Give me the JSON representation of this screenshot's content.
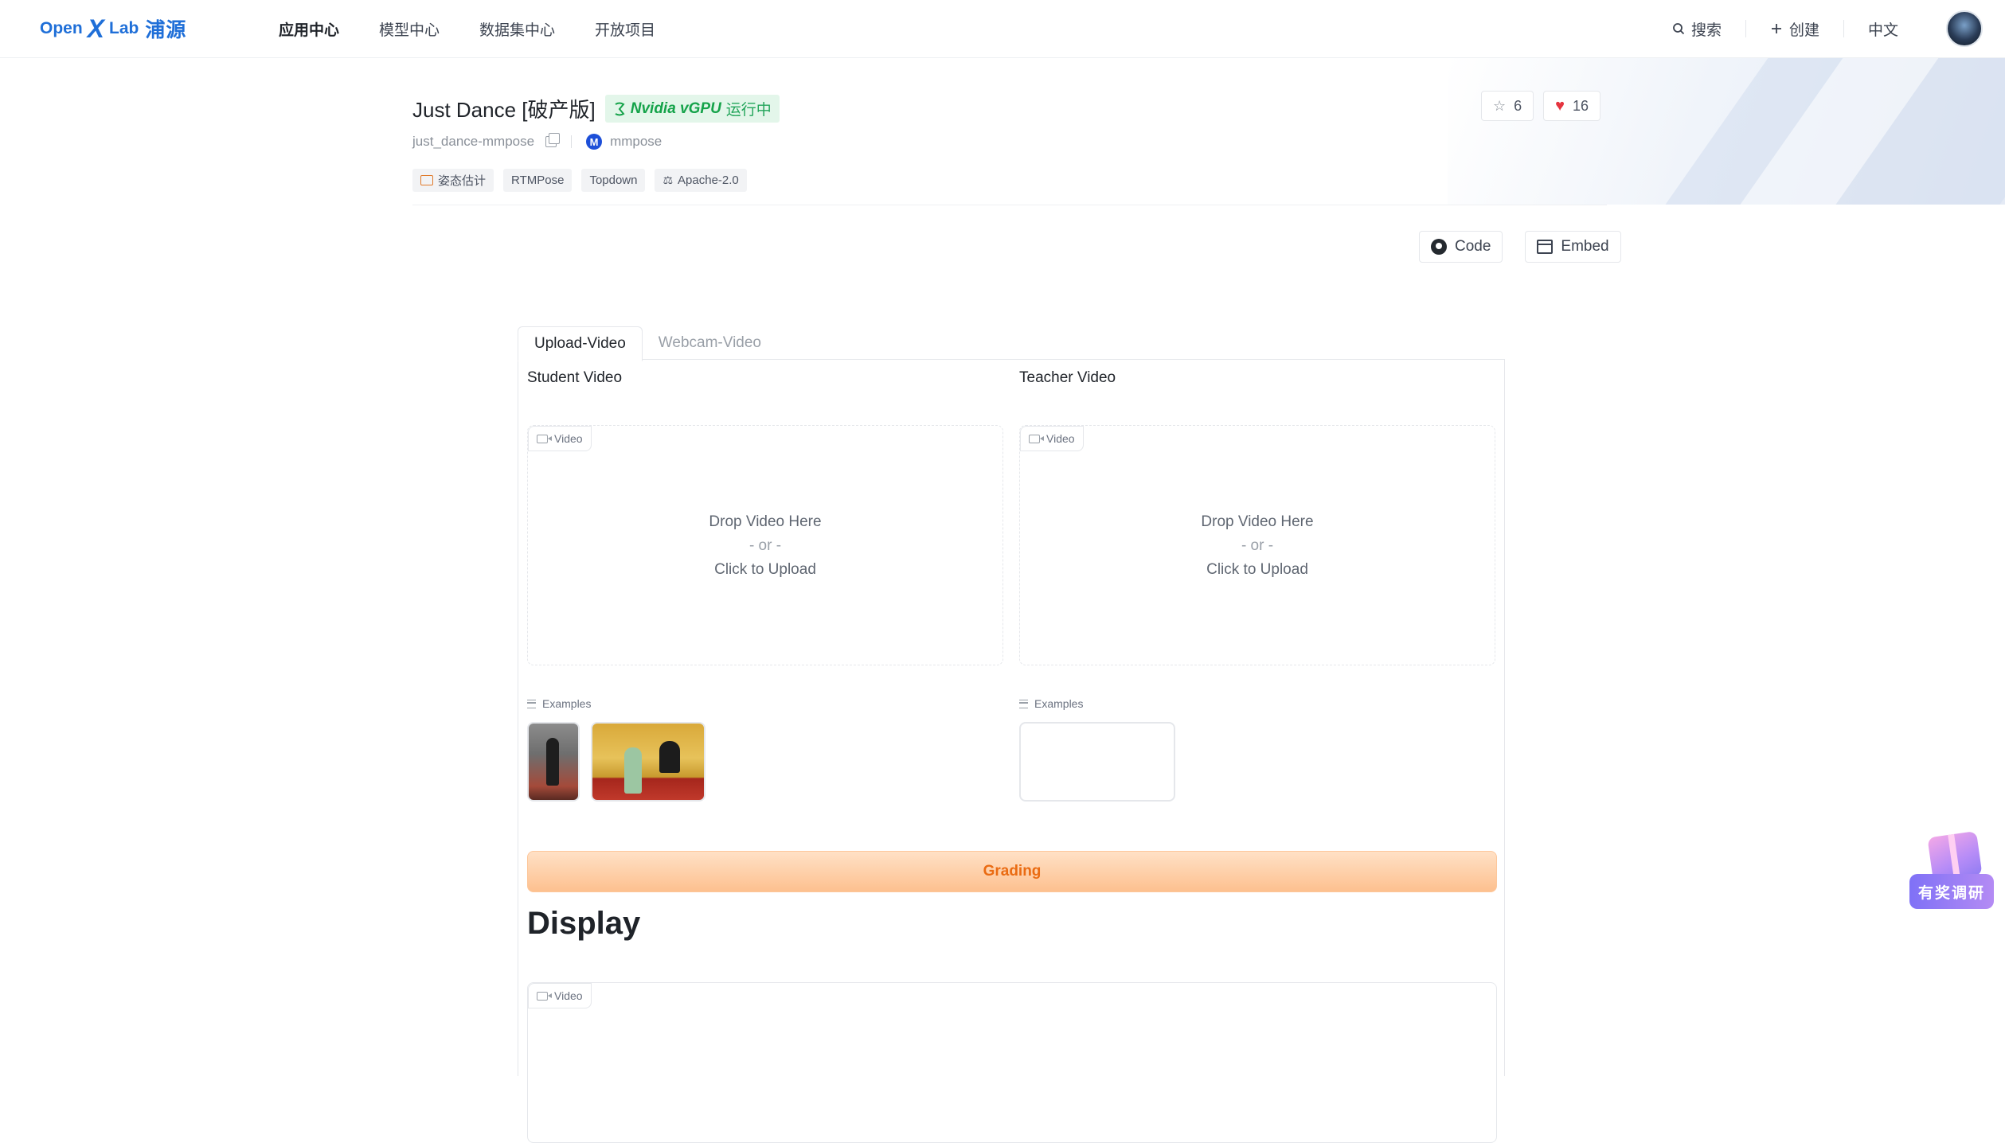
{
  "nav": {
    "logo": {
      "open": "Open",
      "x": "X",
      "lab": "Lab",
      "cn": "浦源"
    },
    "links": [
      {
        "label": "应用中心",
        "active": true
      },
      {
        "label": "模型中心",
        "active": false
      },
      {
        "label": "数据集中心",
        "active": false
      },
      {
        "label": "开放项目",
        "active": false
      }
    ],
    "search_label": "搜索",
    "create_label": "创建",
    "language_label": "中文"
  },
  "header": {
    "title": "Just Dance [破产版]",
    "gpu": "Nvidia vGPU",
    "status": "运行中",
    "repo_id": "just_dance-mmpose",
    "owner_initial": "M",
    "owner": "mmpose",
    "tags": [
      "姿态估计",
      "RTMPose",
      "Topdown",
      "Apache-2.0"
    ],
    "stars": "6",
    "likes": "16",
    "code_label": "Code",
    "embed_label": "Embed"
  },
  "app": {
    "tabs": [
      {
        "label": "Upload-Video",
        "active": true
      },
      {
        "label": "Webcam-Video",
        "active": false
      }
    ],
    "student_label": "Student Video",
    "teacher_label": "Teacher Video",
    "video_label": "Video",
    "drop_line1": "Drop Video Here",
    "drop_line2": "- or -",
    "drop_line3": "Click to Upload",
    "examples_label": "Examples",
    "grading_label": "Grading",
    "display_heading": "Display"
  },
  "survey_label": "有奖调研",
  "colors": {
    "brand": "#1f6fd8",
    "running_green": "#15a34a",
    "grading_orange": "#ea6b12",
    "heart_red": "#e5343f"
  }
}
